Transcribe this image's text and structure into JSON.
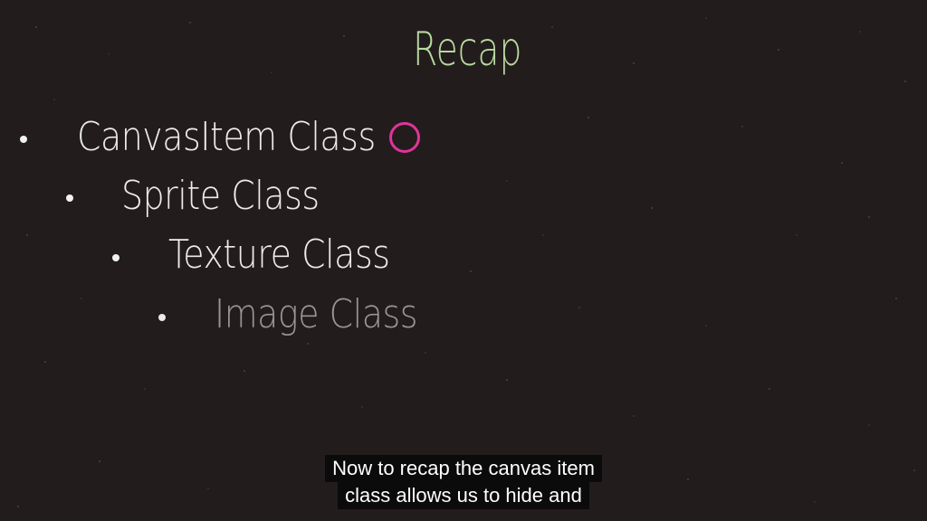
{
  "slide": {
    "title": "Recap",
    "bullets": [
      {
        "text": "CanvasItem Class"
      },
      {
        "text": "Sprite Class"
      },
      {
        "text": "Texture Class"
      },
      {
        "text": "Image Class"
      }
    ]
  },
  "caption": {
    "line1": "Now to recap the canvas item",
    "line2": "class allows us to hide and"
  },
  "colors": {
    "background": "#231c1c",
    "title": "#b7d9a0",
    "bullet_text": "#ececec",
    "bullet_text_dim": "#9a9696",
    "pointer_circle": "#e0349a",
    "caption_bg": "#0b0b0b"
  }
}
